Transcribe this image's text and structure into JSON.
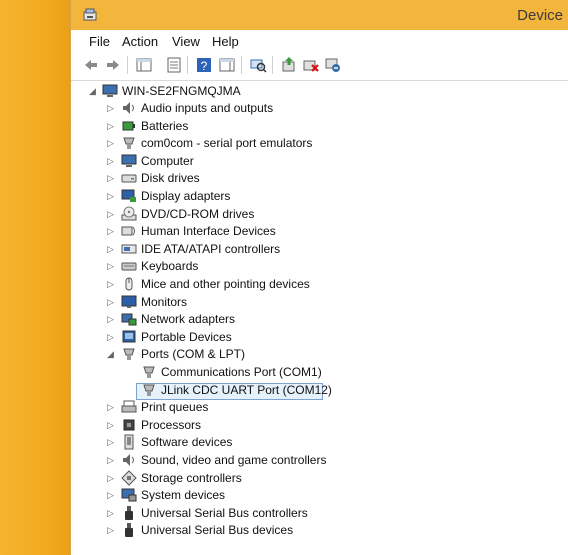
{
  "window": {
    "title": "Device"
  },
  "menu": {
    "file": "File",
    "action": "Action",
    "view": "View",
    "help": "Help"
  },
  "toolbar": {
    "buttons": [
      "back-icon",
      "forward-icon",
      "show-hide-console-tree-icon",
      "properties-icon",
      "help-icon",
      "action-pane-icon",
      "scan-hardware-icon",
      "update-driver-icon",
      "uninstall-icon",
      "disable-icon"
    ]
  },
  "tree": {
    "root": "WIN-SE2FNGMQJMA",
    "nodes": [
      {
        "label": "Audio inputs and outputs",
        "icon": "speaker-icon"
      },
      {
        "label": "Batteries",
        "icon": "battery-icon"
      },
      {
        "label": "com0com - serial port emulators",
        "icon": "port-icon"
      },
      {
        "label": "Computer",
        "icon": "computer-icon"
      },
      {
        "label": "Disk drives",
        "icon": "disk-icon"
      },
      {
        "label": "Display adapters",
        "icon": "display-icon"
      },
      {
        "label": "DVD/CD-ROM drives",
        "icon": "dvd-icon"
      },
      {
        "label": "Human Interface Devices",
        "icon": "hid-icon"
      },
      {
        "label": "IDE ATA/ATAPI controllers",
        "icon": "ide-icon"
      },
      {
        "label": "Keyboards",
        "icon": "keyboard-icon"
      },
      {
        "label": "Mice and other pointing devices",
        "icon": "mouse-icon"
      },
      {
        "label": "Monitors",
        "icon": "monitor-icon"
      },
      {
        "label": "Network adapters",
        "icon": "network-icon"
      },
      {
        "label": "Portable Devices",
        "icon": "portable-icon"
      },
      {
        "label": "Ports (COM & LPT)",
        "icon": "port-icon"
      },
      {
        "label": "Communications Port (COM1)",
        "icon": "port-icon"
      },
      {
        "label": "JLink CDC UART Port (COM12)",
        "icon": "port-icon"
      },
      {
        "label": "Print queues",
        "icon": "printer-icon"
      },
      {
        "label": "Processors",
        "icon": "processor-icon"
      },
      {
        "label": "Software devices",
        "icon": "software-icon"
      },
      {
        "label": "Sound, video and game controllers",
        "icon": "speaker-icon"
      },
      {
        "label": "Storage controllers",
        "icon": "storage-icon"
      },
      {
        "label": "System devices",
        "icon": "system-icon"
      },
      {
        "label": "Universal Serial Bus controllers",
        "icon": "usb-icon"
      },
      {
        "label": "Universal Serial Bus devices",
        "icon": "usb-icon"
      }
    ]
  },
  "colors": {
    "accent": "#f3b53b",
    "selection": "#e5f1fb",
    "selection_border": "#7da2ce"
  }
}
